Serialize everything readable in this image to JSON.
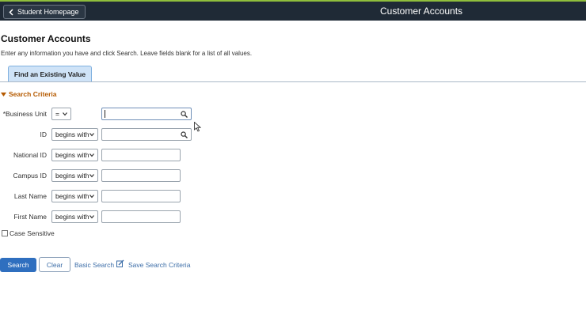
{
  "header": {
    "home_label": "Student Homepage",
    "title": "Customer Accounts",
    "home_icon": "chevron-left-icon"
  },
  "page": {
    "title": "Customer Accounts",
    "instructions": "Enter any information you have and click Search. Leave fields blank for a list of all values."
  },
  "tabs": [
    {
      "label": "Find an Existing Value",
      "active": true
    }
  ],
  "search_criteria": {
    "heading": "Search Criteria",
    "fields": [
      {
        "label": "Business Unit",
        "required_mark": "*",
        "operator": "=",
        "value": "",
        "lookup": true
      },
      {
        "label": "ID",
        "operator": "begins with",
        "value": "",
        "lookup": true
      },
      {
        "label": "National ID",
        "operator": "begins with",
        "value": ""
      },
      {
        "label": "Campus ID",
        "operator": "begins with",
        "value": ""
      },
      {
        "label": "Last Name",
        "operator": "begins with",
        "value": ""
      },
      {
        "label": "First Name",
        "operator": "begins with",
        "value": ""
      }
    ],
    "case_sensitive_label": "Case Sensitive",
    "case_sensitive_checked": false
  },
  "actions": {
    "search_label": "Search",
    "clear_label": "Clear",
    "basic_search_label": "Basic Search",
    "save_criteria_label": "Save Search Criteria"
  },
  "colors": {
    "topbar": "#1f2a36",
    "accent_line": "#8fbe3c",
    "primary_button": "#2f6fbf",
    "link": "#3d6ea8",
    "section_heading": "#b55a00",
    "tab_bg": "#cfe3f7"
  }
}
